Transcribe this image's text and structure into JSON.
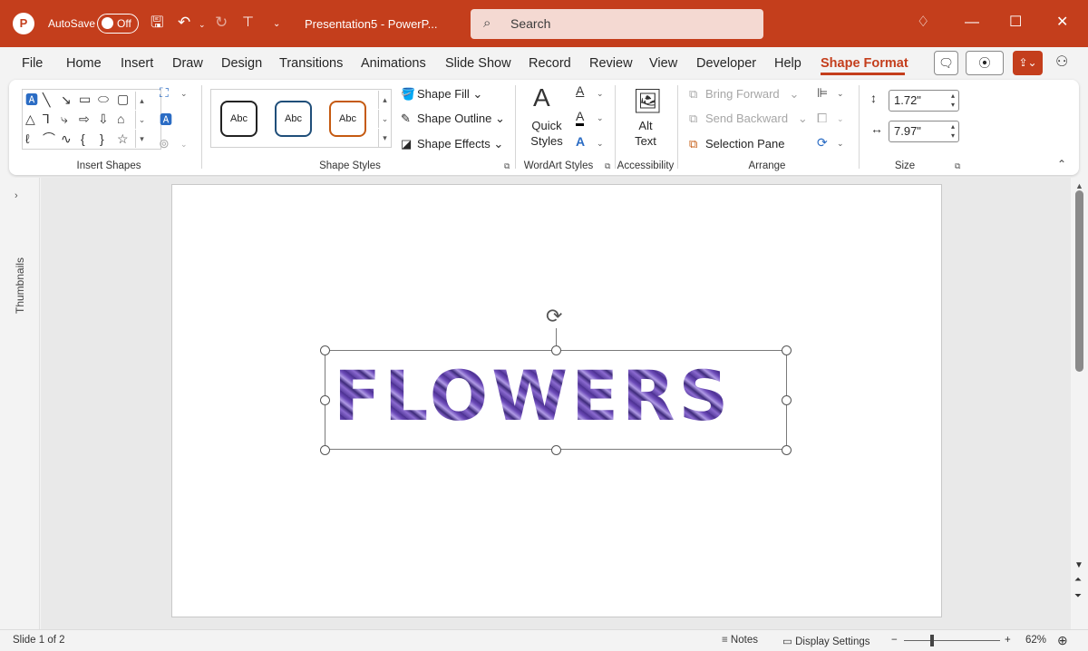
{
  "titlebar": {
    "logo": "P",
    "autosave_label": "AutoSave",
    "autosave_state": "Off",
    "document_name": "Presentation5  -  PowerP...",
    "search_placeholder": "Search",
    "accent_color": "#c43e1c"
  },
  "menu": {
    "tabs": [
      "File",
      "Home",
      "Insert",
      "Draw",
      "Design",
      "Transitions",
      "Animations",
      "Slide Show",
      "Record",
      "Review",
      "View",
      "Developer",
      "Help",
      "Shape Format"
    ],
    "active_tab": "Shape Format"
  },
  "ribbon": {
    "insert_shapes": {
      "label": "Insert Shapes"
    },
    "shape_styles": {
      "label": "Shape Styles",
      "presets": [
        {
          "text": "Abc",
          "border": "#222222"
        },
        {
          "text": "Abc",
          "border": "#1f4e79"
        },
        {
          "text": "Abc",
          "border": "#c55a11"
        }
      ],
      "fill": "Shape Fill",
      "outline": "Shape Outline",
      "effects": "Shape Effects"
    },
    "wordart_styles": {
      "label": "WordArt Styles",
      "quick_styles_line1": "Quick",
      "quick_styles_line2": "Styles"
    },
    "accessibility": {
      "label": "Accessibility",
      "alt_text_line1": "Alt",
      "alt_text_line2": "Text"
    },
    "arrange": {
      "label": "Arrange",
      "bring_forward": "Bring Forward",
      "send_backward": "Send Backward",
      "selection_pane": "Selection Pane"
    },
    "size": {
      "label": "Size",
      "height": "1.72\"",
      "width": "7.97\""
    }
  },
  "sidebar": {
    "thumbnails_label": "Thumbnails"
  },
  "slide": {
    "wordart_text": "FLOWERS"
  },
  "statusbar": {
    "slide_info": "Slide 1 of 2",
    "notes": "Notes",
    "display_settings": "Display Settings",
    "zoom_minus": "−",
    "zoom_plus": "+",
    "zoom_level": "62%"
  }
}
